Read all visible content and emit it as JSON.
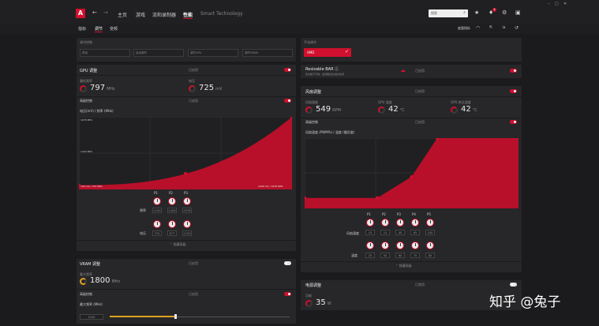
{
  "header": {
    "nav": [
      "主页",
      "游戏",
      "流和录制器",
      "性能",
      "Smart Technology"
    ],
    "active_nav": "性能",
    "search_placeholder": "搜索",
    "notification_count": "4"
  },
  "subtabs": {
    "items": [
      "指标",
      "调节",
      "变频"
    ],
    "active": "调节",
    "right_label": "度量指标"
  },
  "top_fields": {
    "header": "调节控制",
    "fields": [
      "预设",
      "自动调节",
      "调节GPU",
      "调节VRAM"
    ]
  },
  "preset_panel": {
    "header": "手动调节",
    "selected": "AMD"
  },
  "gpu_tuning": {
    "title": "GPU 调整",
    "status": "已启用",
    "min_label": "最低频率",
    "min_value": "797",
    "min_unit": "MHz",
    "voltage_label": "电压",
    "voltage_value": "725",
    "voltage_unit": "mV",
    "advanced_label": "高级控制",
    "advanced_status": "已启用",
    "graph_title": "电压(mV) / 频率 (MHz)",
    "ylabel_top": "1978 MHz",
    "ylabel_mid": "1432 MHz",
    "x_start": "725 mV / 797 MHz",
    "x_end": "1200 mV / 1978 MHz",
    "points": [
      "P1",
      "P2",
      "P3"
    ],
    "freq_label": "频率",
    "freq_values": [
      "1100",
      "1426",
      "2078"
    ],
    "volt_label": "电压",
    "volt_values": [
      "725",
      "877",
      "1150"
    ],
    "expand_label": "隐藏高级"
  },
  "vram_tuning": {
    "title": "VRAM 调整",
    "status": "已启用",
    "freq_label": "最大频率",
    "freq_value": "1800",
    "freq_unit": "MHz",
    "timing_label": "高级控制",
    "timing_status": "已启用",
    "max_label": "最大频率 (MHz)",
    "slider_value": "2100",
    "slider_fraction": 0.36
  },
  "resizable_bar": {
    "title": "Resizable BAR",
    "subtitle": "此功能不可用；监视器设置/指标检测",
    "status": "已启用"
  },
  "fan_tuning": {
    "title": "风扇调整",
    "status": "已启用",
    "speed_label": "风扇速度",
    "speed_value": "549",
    "speed_unit": "RPM",
    "temp_label": "GPU 温度",
    "temp_value": "42",
    "temp_unit": "°C",
    "hotspot_label": "GPU 热点温度",
    "hotspot_value": "42",
    "hotspot_unit": "°C",
    "advanced_label": "高级控制",
    "advanced_status": "已启用",
    "graph_title": "风扇速度 (PWM%) / 温度 (摄氏度)",
    "points": [
      "P1",
      "P2",
      "P3",
      "P4",
      "P5"
    ],
    "speed_row_label": "风扇速度",
    "speed_values": [
      "15",
      "15",
      "40",
      "65",
      "100"
    ],
    "temp_row_label": "温度",
    "temp_values": [
      "25",
      "50",
      "60",
      "70",
      "85"
    ],
    "expand_label": "隐藏高级"
  },
  "power_tuning": {
    "title": "电源调整",
    "status": "已禁用",
    "power_label": "功耗",
    "power_value": "35",
    "power_unit": "W"
  },
  "watermark": "知乎 @兔子",
  "colors": {
    "accent": "#d0102e",
    "bg": "#1b1b1d",
    "card": "#272729"
  },
  "gpu_curve_fraction": [
    [
      0,
      0.06
    ],
    [
      0.5,
      0.22
    ],
    [
      1,
      1
    ]
  ],
  "fan_curve": {
    "x": [
      0,
      0.34,
      0.5,
      0.62,
      1
    ],
    "y": [
      0.15,
      0.15,
      0.45,
      1,
      1
    ]
  }
}
